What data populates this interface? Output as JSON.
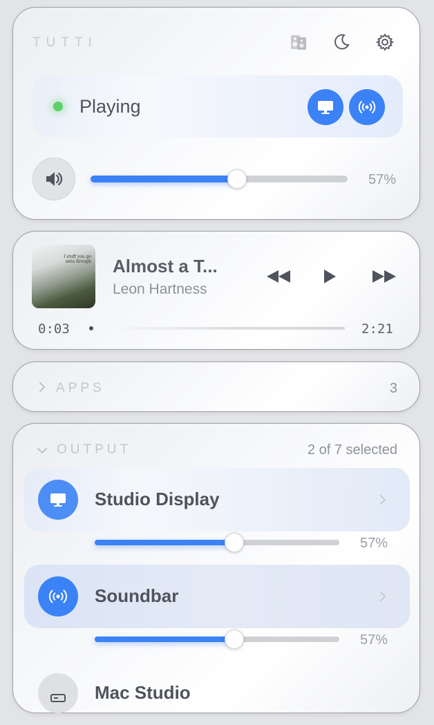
{
  "header": {
    "brand": "TUTTI",
    "icons": [
      "speakers-icon",
      "moon-icon",
      "gear-icon"
    ]
  },
  "status": {
    "label": "Playing",
    "indicator_color": "#5ed16a",
    "active_device_icons": [
      "monitor-icon",
      "broadcast-icon"
    ]
  },
  "master_volume": {
    "level": 0.57,
    "label": "57%"
  },
  "now_playing": {
    "title": "Almost a T...",
    "artist": "Leon Hartness",
    "artwork_caption": "I stuff you go\nanta hrough",
    "elapsed": "0:03",
    "duration": "2:21",
    "controls": [
      "rewind-icon",
      "play-icon",
      "fast-forward-icon"
    ]
  },
  "apps": {
    "label": "APPS",
    "count": "3"
  },
  "output": {
    "label": "OUTPUT",
    "selection": "2 of 7 selected",
    "devices": [
      {
        "name": "Studio Display",
        "icon": "monitor-icon",
        "volume": 0.57,
        "volume_label": "57%"
      },
      {
        "name": "Soundbar",
        "icon": "broadcast-icon",
        "volume": 0.57,
        "volume_label": "57%"
      },
      {
        "name": "Mac Studio",
        "icon": "mac-studio-icon"
      }
    ]
  },
  "colors": {
    "accent": "#3b82f6",
    "status_green": "#5ed16a"
  }
}
